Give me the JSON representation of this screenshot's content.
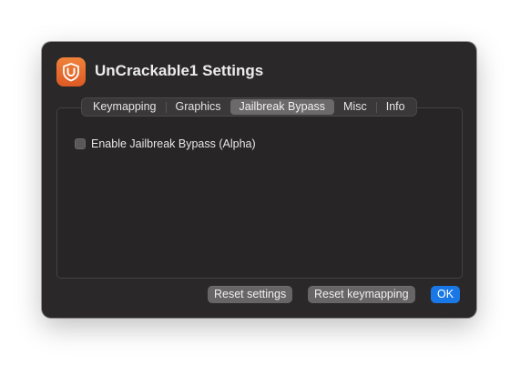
{
  "window": {
    "title": "UnCrackable1 Settings",
    "app_icon": "shield-u-icon",
    "icon_color": "#e8692e"
  },
  "tabs": [
    {
      "label": "Keymapping",
      "active": false
    },
    {
      "label": "Graphics",
      "active": false
    },
    {
      "label": "Jailbreak Bypass",
      "active": true
    },
    {
      "label": "Misc",
      "active": false
    },
    {
      "label": "Info",
      "active": false
    }
  ],
  "jailbreak": {
    "checkbox_label": "Enable Jailbreak Bypass (Alpha)",
    "checked": false
  },
  "buttons": {
    "reset_settings": "Reset settings",
    "reset_keymapping": "Reset keymapping",
    "ok": "OK"
  },
  "colors": {
    "accent": "#1a78e6",
    "background": "#2a2829"
  }
}
